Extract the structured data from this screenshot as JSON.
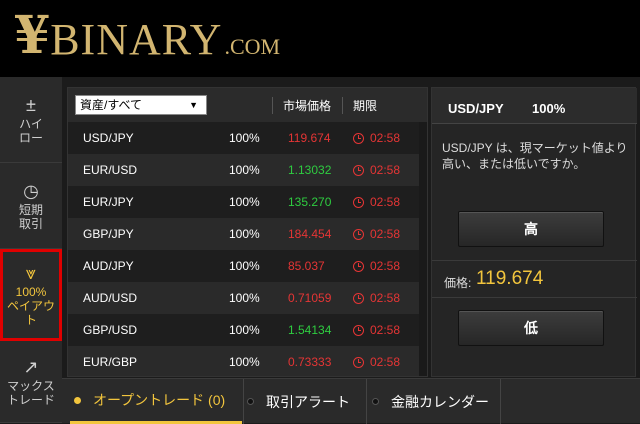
{
  "logo": {
    "yen": "¥",
    "brand": "BINARY",
    "suffix": ".COM"
  },
  "sidebar": {
    "items": [
      {
        "icon": "±",
        "line1": "ハイ",
        "line2": "ロー"
      },
      {
        "icon": "◷",
        "line1": "短期",
        "line2": "取引"
      },
      {
        "icon": "⩔",
        "line1": "100%",
        "line2": "ペイアウト"
      },
      {
        "icon": "↗",
        "line1": "マックス",
        "line2": "トレード"
      }
    ]
  },
  "table": {
    "filter": "資産/すべて",
    "headers": {
      "price": "市場価格",
      "expiry": "期限"
    },
    "rows": [
      {
        "pair": "USD/JPY",
        "payout": "100%",
        "price": "119.674",
        "expiry": "02:58"
      },
      {
        "pair": "EUR/USD",
        "payout": "100%",
        "price": "1.13032",
        "expiry": "02:58"
      },
      {
        "pair": "EUR/JPY",
        "payout": "100%",
        "price": "135.270",
        "expiry": "02:58"
      },
      {
        "pair": "GBP/JPY",
        "payout": "100%",
        "price": "184.454",
        "expiry": "02:58"
      },
      {
        "pair": "AUD/JPY",
        "payout": "100%",
        "price": "85.037",
        "expiry": "02:58"
      },
      {
        "pair": "AUD/USD",
        "payout": "100%",
        "price": "0.71059",
        "expiry": "02:58"
      },
      {
        "pair": "GBP/USD",
        "payout": "100%",
        "price": "1.54134",
        "expiry": "02:58"
      },
      {
        "pair": "EUR/GBP",
        "payout": "100%",
        "price": "0.73333",
        "expiry": "02:58"
      }
    ]
  },
  "trade": {
    "symbol": "USD/JPY",
    "payout": "100%",
    "description": "USD/JPY は、現マーケット値より高い、または低いですか。",
    "high_label": "高",
    "low_label": "低",
    "price_label": "価格:",
    "price_value": "119.674"
  },
  "bottom_tabs": {
    "open": "オープントレード (0)",
    "alerts": "取引アラート",
    "calendar": "金融カレンダー"
  },
  "colors": {
    "accent": "#f2c53d",
    "price_up": "#2ecc40",
    "price_down": "#e53535",
    "brand_gold": "#d2b570"
  }
}
